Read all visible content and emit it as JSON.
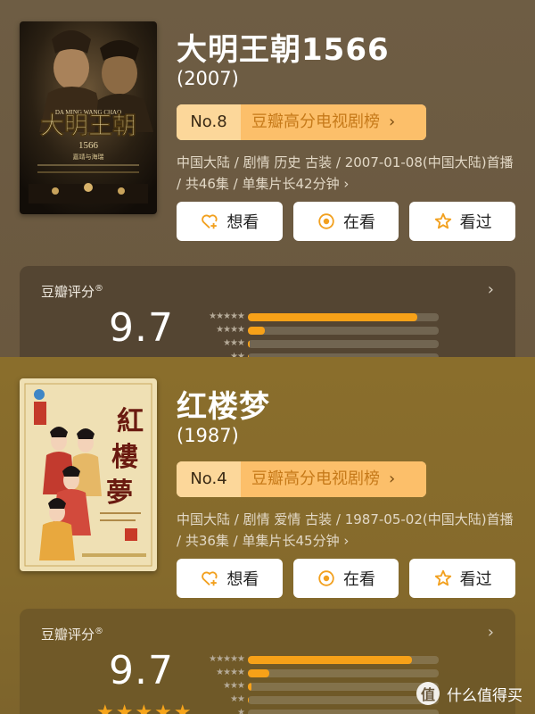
{
  "movies": [
    {
      "title": "大明王朝1566",
      "year": "(2007)",
      "rank_no": "No.8",
      "rank_list": "豆瓣高分电视剧榜",
      "meta": "中国大陆 / 剧情 历史 古装 / 2007-01-08(中国大陆)首播 / 共46集 / 单集片长42分钟 ›",
      "actions": {
        "want": "想看",
        "watching": "在看",
        "watched": "看过"
      },
      "rating": {
        "label": "豆瓣评分",
        "label_mark": "®",
        "score": "9.7",
        "distribution": [
          0.89,
          0.09,
          0.01,
          0.005,
          0.0
        ]
      },
      "poster": {
        "title_text": "大明王朝",
        "pinyin_text": "DA MING WANG CHAO",
        "number_text": "1566",
        "sub_text": "嘉靖与海瑞"
      }
    },
    {
      "title": "红楼梦",
      "year": "(1987)",
      "rank_no": "No.4",
      "rank_list": "豆瓣高分电视剧榜",
      "meta": "中国大陆 / 剧情 爱情 古装 / 1987-05-02(中国大陆)首播 / 共36集 / 单集片长45分钟 ›",
      "actions": {
        "want": "想看",
        "watching": "在看",
        "watched": "看过"
      },
      "rating": {
        "label": "豆瓣评分",
        "label_mark": "®",
        "score": "9.7",
        "stars": "★★★★★",
        "distribution": [
          0.86,
          0.11,
          0.02,
          0.005,
          0.0
        ]
      },
      "poster": {
        "title_text": "紅樓夢"
      }
    }
  ],
  "dist_star_labels": [
    "★★★★★",
    "★★★★",
    "★★★",
    "★★",
    "★"
  ],
  "colors": {
    "accent": "#f7a118",
    "rank_bg": "#fcbf6a",
    "rank_no_bg": "#fcd79a"
  },
  "brand": {
    "text": "什么值得买",
    "logo": "值"
  }
}
